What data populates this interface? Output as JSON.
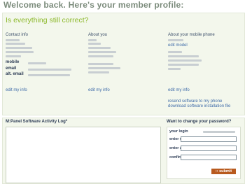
{
  "page_title": "Welcome back.  Here's your member profile:",
  "profile": {
    "question": "Is everything still correct?",
    "contact": {
      "header": "Contact info",
      "mobile_label": "mobile",
      "email_label": "email",
      "alt_email_label": "alt. email",
      "edit_link": "edit my info"
    },
    "about": {
      "header": "About you",
      "edit_link": "edit my info"
    },
    "mobile_phone": {
      "header": "About your mobile phone",
      "edit_model_link": "edit model",
      "edit_link": "edit my info",
      "resend_link": "resend software to my phone",
      "download_link": "download software installation file"
    }
  },
  "activity_log": {
    "title": "M:Panel Software Activity Log*"
  },
  "password": {
    "title": "Want to change your password?",
    "login_label": "your login",
    "current_label": "enter current password",
    "new_label": "enter a new password",
    "confirm_label": "confirm new password",
    "submit_label": ":: submit"
  },
  "colors": {
    "accent_green": "#8cb82a",
    "panel_bg": "#f3f7ec",
    "submit_bg": "#b85a1e",
    "link": "#3d6aa8"
  }
}
